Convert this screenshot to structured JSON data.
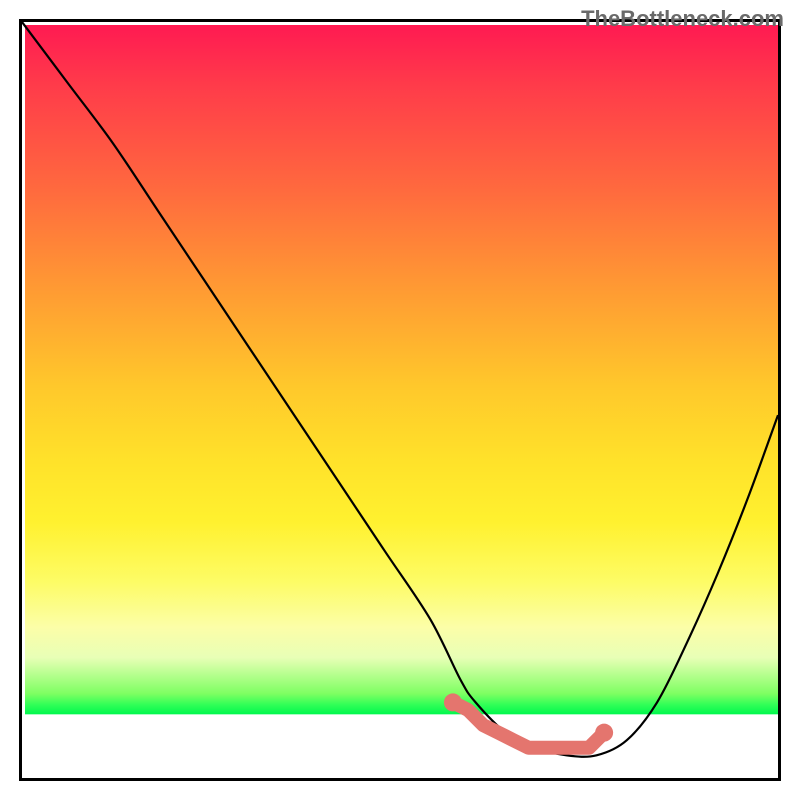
{
  "watermark": "TheBottleneck.com",
  "chart_data": {
    "type": "line",
    "title": "",
    "xlabel": "",
    "ylabel": "",
    "xlim": [
      0,
      100
    ],
    "ylim": [
      0,
      100
    ],
    "grid": false,
    "legend": false,
    "series": [
      {
        "name": "bottleneck-curve",
        "kind": "line",
        "color": "#000000",
        "x": [
          0,
          6,
          12,
          18,
          24,
          30,
          36,
          42,
          48,
          54,
          58,
          60,
          64,
          68,
          72,
          76,
          80,
          84,
          88,
          92,
          96,
          100
        ],
        "values": [
          100,
          92,
          84,
          75,
          66,
          57,
          48,
          39,
          30,
          21,
          13,
          10,
          6,
          4,
          3,
          3,
          5,
          10,
          18,
          27,
          37,
          48
        ]
      },
      {
        "name": "bottleneck-highlight",
        "kind": "scatter",
        "color": "#e4756e",
        "x": [
          57,
          59,
          61,
          63,
          65,
          67,
          69,
          71,
          73,
          75,
          77
        ],
        "values": [
          10,
          9,
          7,
          6,
          5,
          4,
          4,
          4,
          4,
          4,
          6
        ]
      }
    ],
    "background_gradient": {
      "orientation": "vertical",
      "stops": [
        {
          "pos": 0.0,
          "color": "#ff1a52"
        },
        {
          "pos": 0.22,
          "color": "#ff6a3e"
        },
        {
          "pos": 0.48,
          "color": "#ffc82b"
        },
        {
          "pos": 0.66,
          "color": "#fff12f"
        },
        {
          "pos": 0.8,
          "color": "#fcfea8"
        },
        {
          "pos": 0.9,
          "color": "#02f84e"
        },
        {
          "pos": 0.92,
          "color": "#ffffff"
        },
        {
          "pos": 1.0,
          "color": "#ffffff"
        }
      ]
    }
  }
}
